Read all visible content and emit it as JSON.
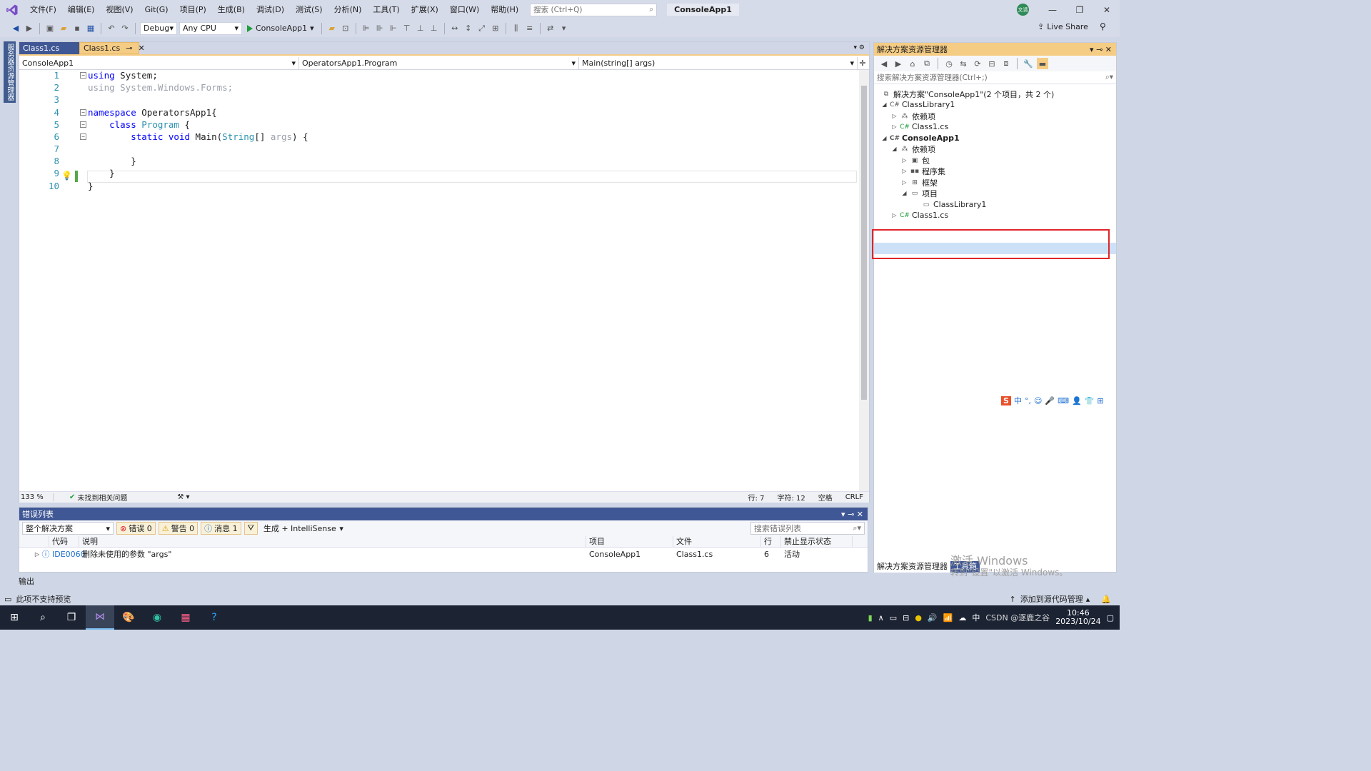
{
  "menu": {
    "items": [
      "文件(F)",
      "编辑(E)",
      "视图(V)",
      "Git(G)",
      "项目(P)",
      "生成(B)",
      "调试(D)",
      "测试(S)",
      "分析(N)",
      "工具(T)",
      "扩展(X)",
      "窗口(W)",
      "帮助(H)"
    ],
    "search_placeholder": "搜索 (Ctrl+Q)",
    "app_title": "ConsoleApp1",
    "user_badge": "文请"
  },
  "toolbar": {
    "config": "Debug",
    "platform": "Any CPU",
    "run_label": "ConsoleApp1",
    "live_share": "Live Share"
  },
  "left_strip": {
    "label": "服务器资源管理器"
  },
  "editor": {
    "tabs": [
      {
        "label": "Class1.cs",
        "pin": "",
        "close": ""
      },
      {
        "label": "Class1.cs",
        "pin": "⊸",
        "close": "✕"
      }
    ],
    "nav": {
      "project": "ConsoleApp1",
      "type": "OperatorsApp1.Program",
      "member": "Main(string[] args)"
    },
    "line_numbers": [
      "1",
      "2",
      "3",
      "4",
      "5",
      "6",
      "7",
      "8",
      "9",
      "10"
    ],
    "status": {
      "zoom": "133 %",
      "issues": "未找到相关问题",
      "line": "行: 7",
      "char": "字符: 12",
      "spaces": "空格",
      "eol": "CRLF"
    }
  },
  "error_list": {
    "title": "错误列表",
    "scope": "整个解决方案",
    "errors": "错误 0",
    "warnings": "警告 0",
    "messages": "消息 1",
    "build_filter": "生成 + IntelliSense",
    "search_placeholder": "搜索错误列表",
    "columns": [
      "代码",
      "说明",
      "项目",
      "文件",
      "行",
      "禁止显示状态"
    ],
    "rows": [
      {
        "code": "IDE0060",
        "description": "删除未使用的参数 \"args\"",
        "project": "ConsoleApp1",
        "file": "Class1.cs",
        "line": "6",
        "suppression": "活动"
      }
    ]
  },
  "output_tab": "输出",
  "solution_explorer": {
    "title": "解决方案资源管理器",
    "search_placeholder": "搜索解决方案资源管理器(Ctrl+;)",
    "solution_label": "解决方案\"ConsoleApp1\"(2 个项目，共 2 个)",
    "tree": {
      "classlibrary1": "ClassLibrary1",
      "cl_deps": "依赖项",
      "cl_class1": "Class1.cs",
      "consoleapp1": "ConsoleApp1",
      "ca_deps": "依赖项",
      "packages": "包",
      "assemblies": "程序集",
      "frameworks": "框架",
      "projects": "项目",
      "project_ref": "ClassLibrary1",
      "ca_class1": "Class1.cs"
    },
    "bottom_tabs": [
      "解决方案资源管理器",
      "工具箱"
    ]
  },
  "watermark": {
    "line1": "激活 Windows",
    "line2": "转到\"设置\"以激活 Windows。"
  },
  "statusbar": {
    "left": "此项不支持预览",
    "right": "添加到源代码管理"
  },
  "taskbar": {
    "time": "10:46",
    "date": "2023/10/24",
    "ime": "中",
    "csdn": "CSDN @逐鹿之谷"
  },
  "colors": {
    "keyword": "#0000ff",
    "type": "#2b91af",
    "selection_box": "#e0252a",
    "tab_active": "#f5cc84",
    "chrome": "#3f5794"
  }
}
